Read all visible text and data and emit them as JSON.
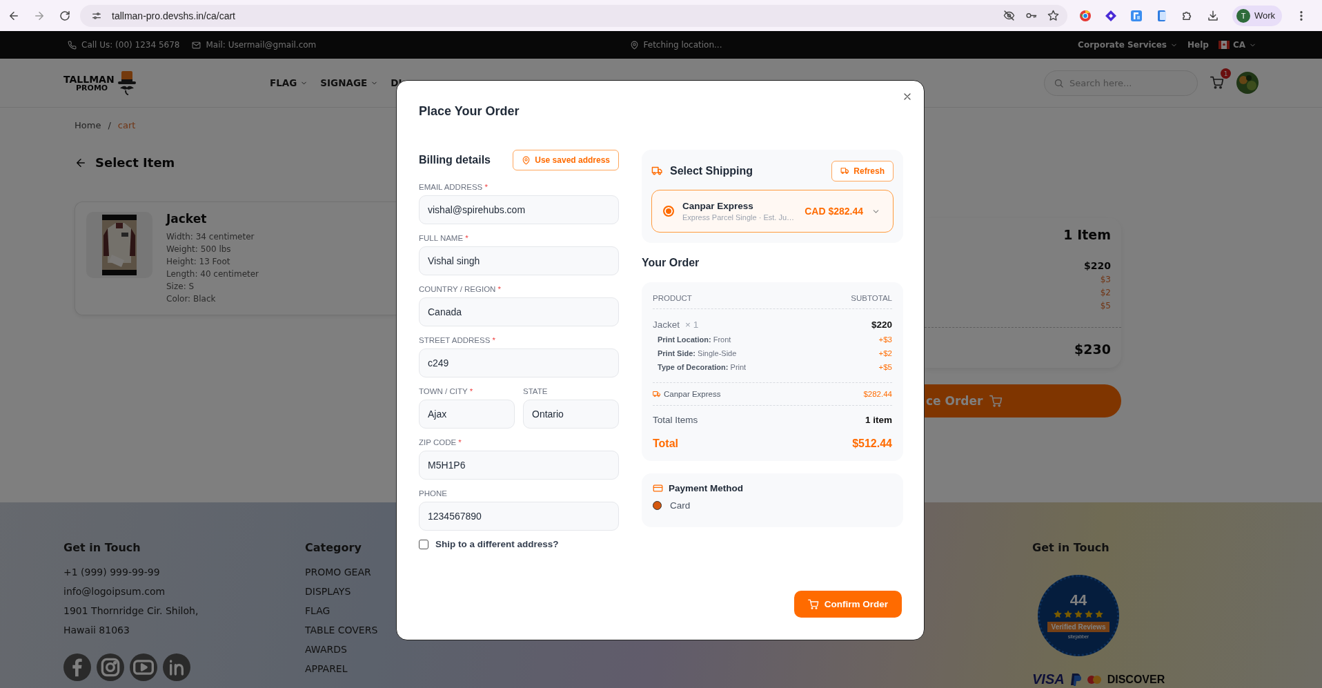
{
  "browser": {
    "url": "tallman-pro.devshs.in/ca/cart",
    "profile_initial": "T",
    "profile_label": "Work"
  },
  "top_bar": {
    "phone": "Call Us: (00) 1234 5678",
    "mail": "Mail: Usermail@gmail.com",
    "location": "Fetching location...",
    "links": [
      {
        "label": "Corporate Services",
        "dropdown": true
      },
      {
        "label": "Help",
        "dropdown": false
      }
    ],
    "country": "CA"
  },
  "header": {
    "logo_top": "TALLMAN",
    "logo_bottom": "PROMO",
    "nav": [
      {
        "label": "FLAG",
        "dropdown": true
      },
      {
        "label": "SIGNAGE",
        "dropdown": true
      },
      {
        "label": "DI",
        "dropdown": false
      }
    ],
    "search": {
      "placeholder": "Search here..."
    },
    "cart_count": "1"
  },
  "breadcrumb": {
    "separator": "/",
    "items": [
      {
        "label": "Home",
        "current": false
      },
      {
        "label": "cart",
        "current": true
      }
    ]
  },
  "page_title": "Select Item",
  "cart_item": {
    "name": "Jacket",
    "details": [
      "Width: 34 centimeter",
      "Weight: 500 lbs",
      "Height: 13 Foot",
      "Length: 40 centimeter",
      "Size: S",
      "Color: Black"
    ]
  },
  "summary": {
    "count": "1 Item",
    "price": "$220",
    "extras": [
      "$3",
      "$2",
      "$5"
    ],
    "total": "$230",
    "button": "ce Order"
  },
  "footer": {
    "contact": {
      "title": "Get in Touch",
      "lines": [
        "+1 (999) 999-99-99",
        "info@logoipsum.com",
        "1901 Thornridge Cir. Shiloh, Hawaii 81063"
      ]
    },
    "category": {
      "title": "Category",
      "items": [
        "PROMO GEAR",
        "DISPLAYS",
        "FLAG",
        "TABLE COVERS",
        "AWARDS",
        "APPAREL"
      ]
    },
    "reviews": {
      "title": "Get in Touch",
      "count": "44",
      "stars": 5,
      "label": "Verified Reviews",
      "brand": "sitejabber"
    },
    "payments": [
      "VISA",
      "DISCOVER"
    ]
  },
  "modal": {
    "title": "Place Your Order",
    "billing": {
      "title": "Billing details",
      "saved_button": "Use saved address",
      "rows": [
        [
          {
            "label": "EMAIL ADDRESS",
            "marker": "*",
            "value": "vishal@spirehubs.com"
          }
        ],
        [
          {
            "label": "FULL NAME",
            "marker": "*",
            "value": "Vishal singh"
          }
        ],
        [
          {
            "label": "COUNTRY / REGION",
            "marker": "*",
            "value": "Canada"
          }
        ],
        [
          {
            "label": "STREET ADDRESS",
            "marker": "*",
            "value": "c249"
          }
        ],
        [
          {
            "label": "TOWN / CITY",
            "marker": "*",
            "value": "Ajax"
          },
          {
            "label": "STATE",
            "value": "Ontario"
          }
        ],
        [
          {
            "label": "ZIP CODE",
            "marker": "*",
            "value": "M5H1P6"
          }
        ],
        [
          {
            "label": "PHONE",
            "value": "1234567890"
          }
        ]
      ],
      "ship_different": {
        "label": "Ship to a different address?",
        "checked": false
      }
    },
    "shipping": {
      "title": "Select Shipping",
      "refresh": "Refresh",
      "options": [
        {
          "name": "Canpar Express",
          "detail": "Express Parcel Single · Est. Ju…",
          "price": "CAD $282.44",
          "selected": true
        }
      ]
    },
    "order": {
      "title": "Your Order",
      "columns": [
        "PRODUCT",
        "SUBTOTAL"
      ],
      "items": [
        {
          "name": "Jacket",
          "qty": "× 1",
          "price": "$220",
          "options": [
            {
              "text": "**Print Location:** Front",
              "price": "+$3"
            },
            {
              "text": "**Print Side:** Single-Side",
              "price": "+$2"
            },
            {
              "text": "**Type of Decoration:** Print",
              "price": "+$5"
            }
          ]
        }
      ],
      "shipping": {
        "name": "Canpar Express",
        "price": "$282.44"
      },
      "total_items": {
        "label": "Total Items",
        "value": "1 item"
      },
      "total": {
        "label": "Total",
        "value": "$512.44"
      }
    },
    "payment": {
      "title": "Payment Method",
      "methods": [
        {
          "label": "Card",
          "selected": true
        }
      ]
    },
    "confirm": "Confirm Order"
  }
}
